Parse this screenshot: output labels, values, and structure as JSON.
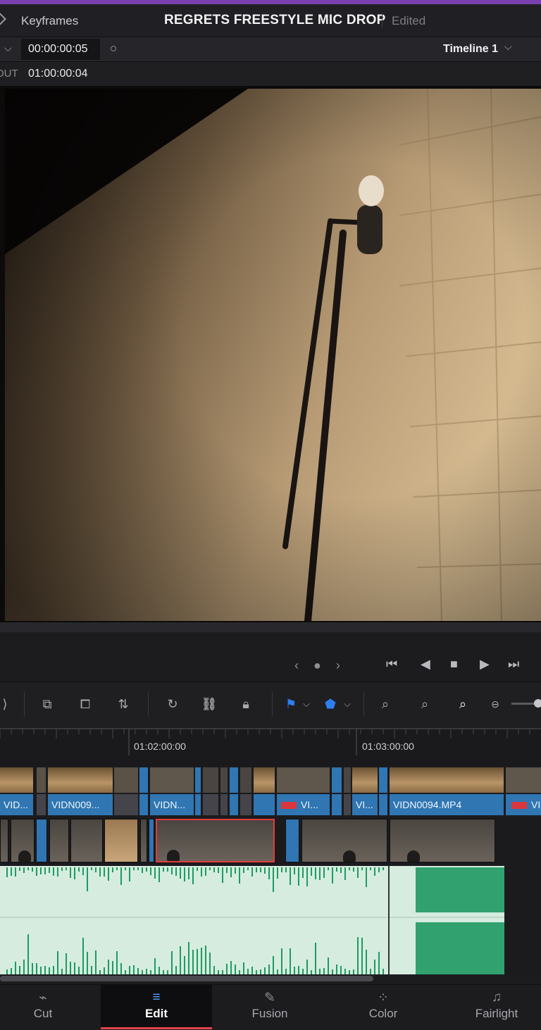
{
  "header": {
    "keyframes_label": "Keyframes",
    "project_title": "REGRETS FREESTYLE MIC DROP",
    "status": "Edited"
  },
  "timecode": {
    "current": "00:00:00:05",
    "timeline_name": "Timeline 1",
    "out_label": "OUT",
    "out_value": "01:00:00:04"
  },
  "transport": {
    "jog": "‹ ● ›",
    "first": "⏮",
    "prev": "◀",
    "stop": "■",
    "play": "▶",
    "last": "⏭"
  },
  "ruler": {
    "marks": [
      "01:02:00:00",
      "01:03:00:00"
    ]
  },
  "tracks": {
    "v2_labels": [
      "VID...",
      "VIDN009...",
      "VIDN...",
      "VI...",
      "VI...",
      "VIDN0094.MP4",
      "VI"
    ]
  },
  "pages": [
    {
      "label": "Cut",
      "icon": "cut-icon"
    },
    {
      "label": "Edit",
      "icon": "edit-icon"
    },
    {
      "label": "Fusion",
      "icon": "fusion-icon"
    },
    {
      "label": "Color",
      "icon": "color-icon"
    },
    {
      "label": "Fairlight",
      "icon": "fairlight-icon"
    }
  ],
  "colors": {
    "accent": "#7b3fb0",
    "clip_blue": "#2f76b3",
    "audio_green": "#1f9a63",
    "selected_clip": "#e23b3b"
  }
}
